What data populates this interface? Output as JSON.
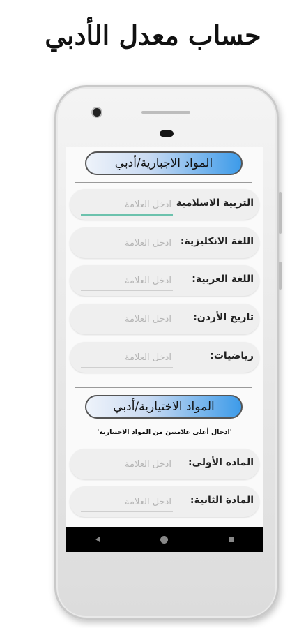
{
  "promo": {
    "title": "حساب معدل الأدبي"
  },
  "mandatory": {
    "header": "المواد الاجبارية/أدبي",
    "subjects": [
      {
        "label": "التربية الاسلامية",
        "placeholder": "ادخل العلامة",
        "value": ""
      },
      {
        "label": "اللغة الانكليزية:",
        "placeholder": "ادخل العلامة",
        "value": ""
      },
      {
        "label": "اللغة العربية:",
        "placeholder": "ادخل العلامة",
        "value": ""
      },
      {
        "label": "تاريخ الأردن:",
        "placeholder": "ادخل العلامة",
        "value": ""
      },
      {
        "label": "رياضيات:",
        "placeholder": "ادخل العلامة",
        "value": ""
      }
    ]
  },
  "elective": {
    "header": "المواد الاختيارية/أدبي",
    "note": "'ادخال أعلى علامتين من المواد الاختيارية'",
    "subjects": [
      {
        "label": "المادة الأولى:",
        "placeholder": "ادخل العلامة",
        "value": ""
      },
      {
        "label": "المادة الثانية:",
        "placeholder": "ادخل العلامة",
        "value": ""
      }
    ]
  },
  "navbar": {
    "icons": [
      "back-icon",
      "home-icon",
      "recents-icon"
    ]
  },
  "colors": {
    "header_accent": "#3d9be9",
    "focus_underline": "#6cc2ad",
    "navbar": "#000000"
  }
}
